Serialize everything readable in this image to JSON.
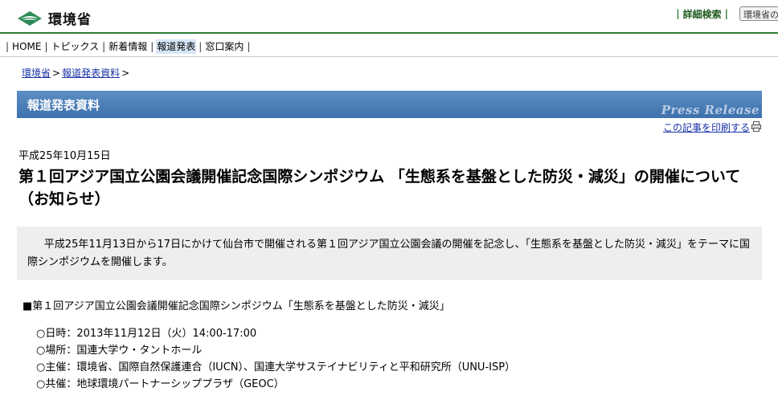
{
  "header": {
    "logo_text": "環境省",
    "advanced_search_label": "詳細検索",
    "search_box_text": "環境省の"
  },
  "nav": {
    "items": [
      {
        "label": "HOME",
        "active": false
      },
      {
        "label": "トピックス",
        "active": false
      },
      {
        "label": "新着情報",
        "active": false
      },
      {
        "label": "報道発表",
        "active": true
      },
      {
        "label": "窓口案内",
        "active": false
      }
    ],
    "separator": "|"
  },
  "breadcrumb": {
    "items": [
      "環境省",
      "報道発表資料"
    ],
    "arrow": ">"
  },
  "band": {
    "title": "報道発表資料",
    "subtitle": "Press Release"
  },
  "print_link": "この記事を印刷する",
  "article": {
    "date": "平成25年10月15日",
    "headline": "第１回アジア国立公園会議開催記念国際シンポジウム 「生態系を基盤とした防災・減災」の開催について （お知らせ）",
    "lead": "平成25年11月13日から17日にかけて仙台市で開催される第１回アジア国立公園会議の開催を記念し、「生態系を基盤とした防災・減災」をテーマに国際シンポジウムを開催します。",
    "symposium_title": "■第１回アジア国立公園会議開催記念国際シンポジウム「生態系を基盤とした防災・減災」",
    "details": [
      "○日時：2013年11月12日（火）14:00-17:00",
      "○場所：国連大学ウ・タントホール",
      "○主催：環境省、国際自然保護連合（IUCN）、国連大学サステイナビリティと平和研究所（UNU-ISP）",
      "○共催：地球環境パートナーシッププラザ（GEOC）"
    ]
  },
  "colors": {
    "band_blue": "#4a7db8",
    "header_green": "#2e7d32",
    "link_blue": "#1a33a8",
    "lead_bg": "#eeeeee"
  }
}
